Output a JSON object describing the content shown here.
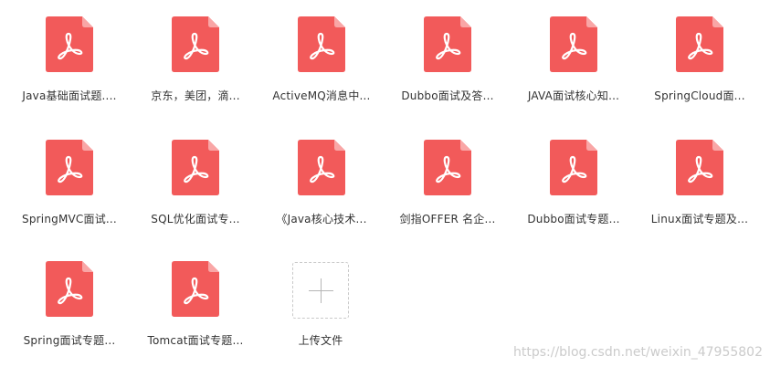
{
  "files": [
    {
      "name": "Java基础面试题...."
    },
    {
      "name": "京东，美团，滴..."
    },
    {
      "name": "ActiveMQ消息中..."
    },
    {
      "name": "Dubbo面试及答..."
    },
    {
      "name": "JAVA面试核心知..."
    },
    {
      "name": "SpringCloud面..."
    },
    {
      "name": "SpringMVC面试..."
    },
    {
      "name": "SQL优化面试专..."
    },
    {
      "name": "《Java核心技术..."
    },
    {
      "name": "剑指OFFER  名企..."
    },
    {
      "name": "Dubbo面试专题..."
    },
    {
      "name": "Linux面试专题及..."
    },
    {
      "name": "Spring面试专题..."
    },
    {
      "name": "Tomcat面试专题..."
    }
  ],
  "upload": {
    "label": "上传文件"
  },
  "watermark": "https://blog.csdn.net/weixin_47955802",
  "icon": {
    "name": "pdf-file-icon",
    "color": "#f25a5a",
    "fold_color": "#f9a6a6"
  }
}
